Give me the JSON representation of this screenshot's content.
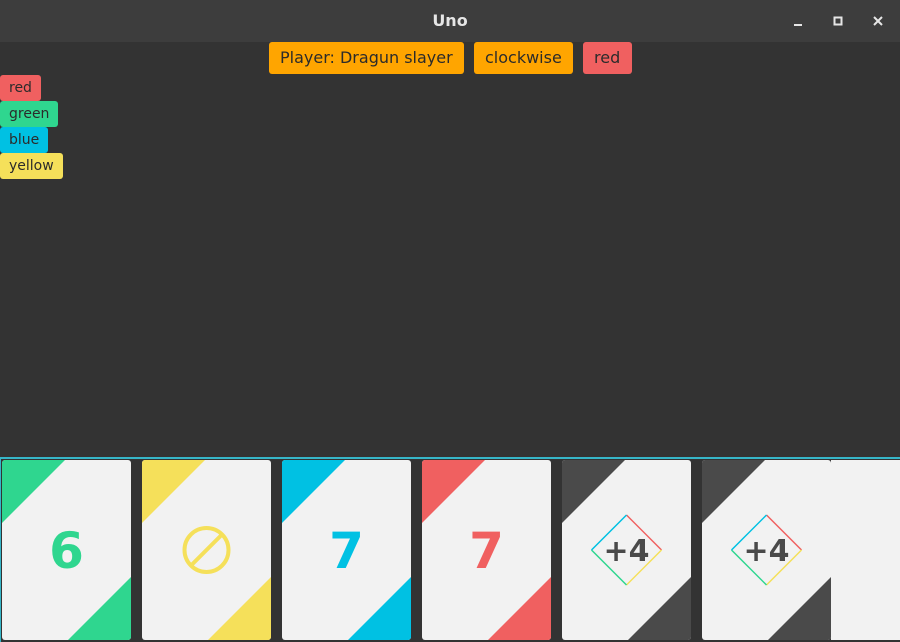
{
  "window": {
    "title": "Uno"
  },
  "status": {
    "player": "Player: Dragun slayer",
    "direction": "clockwise",
    "current_color": "red"
  },
  "color_choices": [
    {
      "label": "red",
      "color": "#f06060"
    },
    {
      "label": "green",
      "color": "#2fd68f"
    },
    {
      "label": "blue",
      "color": "#00c1e3"
    },
    {
      "label": "yellow",
      "color": "#f5e05a"
    }
  ],
  "colors": {
    "accent_orange": "#ffa500",
    "background": "#333333",
    "titlebar": "#3d3d3d",
    "card_face": "#f2f2f2",
    "wild_corner": "#4a4a4a",
    "hand_border": "#36b6c8"
  },
  "hand": [
    {
      "value": "6",
      "color": "#2fd68f",
      "kind": "number"
    },
    {
      "value": "",
      "color": "#f5e05a",
      "kind": "skip",
      "icon": "skip-icon"
    },
    {
      "value": "7",
      "color": "#00c1e3",
      "kind": "number"
    },
    {
      "value": "7",
      "color": "#f06060",
      "kind": "number"
    },
    {
      "value": "+4",
      "color": "#4a4a4a",
      "kind": "wild-draw-four"
    },
    {
      "value": "+4",
      "color": "#4a4a4a",
      "kind": "wild-draw-four"
    }
  ]
}
